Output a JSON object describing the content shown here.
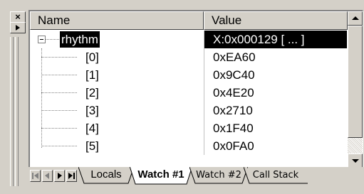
{
  "window_controls": {
    "close_glyph": "×"
  },
  "columns": {
    "name": "Name",
    "value": "Value"
  },
  "watch": {
    "root": {
      "name": "rhythm",
      "value": "X:0x000129 [ ... ]"
    },
    "children": [
      {
        "name": "[0]",
        "value": "0xEA60"
      },
      {
        "name": "[1]",
        "value": "0x9C40"
      },
      {
        "name": "[2]",
        "value": "0x4E20"
      },
      {
        "name": "[3]",
        "value": "0x2710"
      },
      {
        "name": "[4]",
        "value": "0x1F40"
      },
      {
        "name": "[5]",
        "value": "0x0FA0"
      }
    ]
  },
  "tabs": [
    "Locals",
    "Watch #1",
    "Watch #2",
    "Call Stack"
  ],
  "active_tab": "Watch #1",
  "icons": [
    "close-icon",
    "restore-icon",
    "expand-collapse-icon",
    "scroll-up-icon",
    "scroll-down-icon",
    "first-tab-icon",
    "prev-tab-icon",
    "next-tab-icon",
    "last-tab-icon"
  ]
}
